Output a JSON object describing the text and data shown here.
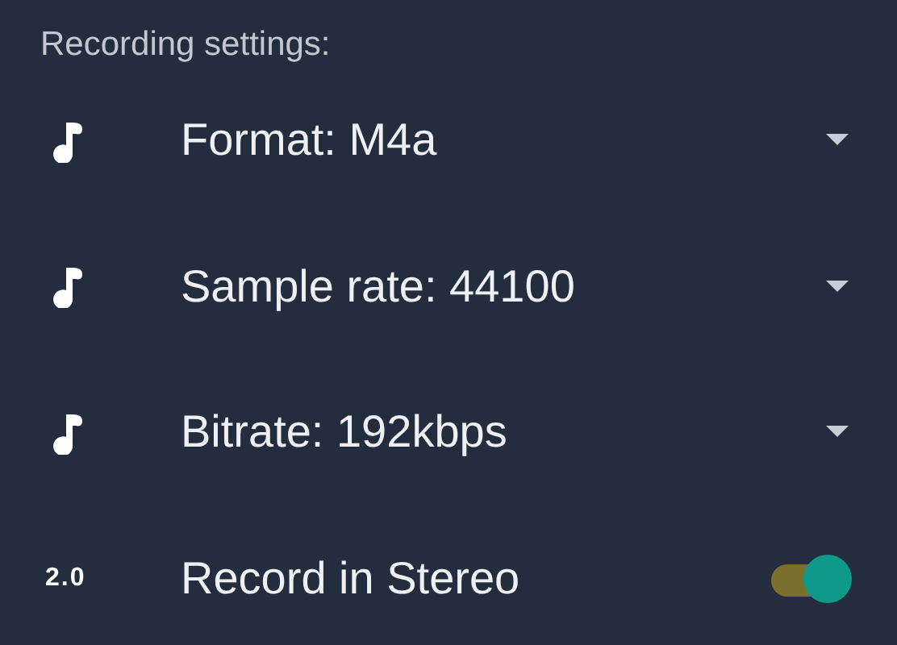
{
  "section_title": "Recording settings:",
  "settings": [
    {
      "kind": "dropdown",
      "label": "Format: M4a"
    },
    {
      "kind": "dropdown",
      "label": "Sample rate: 44100"
    },
    {
      "kind": "dropdown",
      "label": "Bitrate: 192kbps"
    },
    {
      "kind": "toggle",
      "badge": "2.0",
      "label": "Record in Stereo",
      "on": true
    }
  ]
}
